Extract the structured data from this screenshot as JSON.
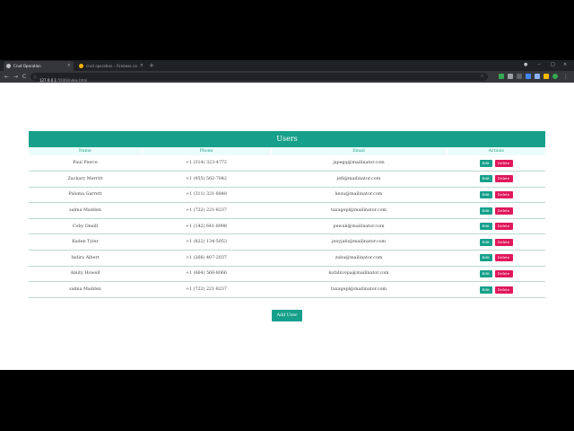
{
  "browser": {
    "tabs": [
      {
        "title": "Crud Operation",
        "active": true
      },
      {
        "title": "crud operation – Firebase conso…",
        "active": false
      }
    ],
    "new_tab": "+",
    "tab_close": "×",
    "window_controls": {
      "minimize": "–",
      "maximize": "□",
      "close": "×"
    },
    "nav": {
      "back": "←",
      "forward": "→",
      "reload": "C"
    },
    "url_host": "127.0.0.1",
    "url_path": ":5500/index.html",
    "colors": {
      "frame": "#202124",
      "toolbar": "#35363a"
    }
  },
  "page": {
    "header": "Users",
    "columns": [
      "Name",
      "Phone",
      "Email",
      "Actions"
    ],
    "rows": [
      {
        "name": "Paul Pierce",
        "phone": "+1 (314) 323-4772",
        "email": "japegq@mailinator.com"
      },
      {
        "name": "Zachary Merritt",
        "phone": "+1 (955) 562-7842",
        "email": "jefi@mailinator.com"
      },
      {
        "name": "Paloma Garrett",
        "phone": "+1 (311) 331-8848",
        "email": "kexu@mailinator.com"
      },
      {
        "name": "salma Madden",
        "phone": "+1 (722) 221-8237",
        "email": "taxugepl@mailinator.com"
      },
      {
        "name": "Coby Oneill",
        "phone": "+1 (142) 641-8998",
        "email": "pewuk@mailinator.com"
      },
      {
        "name": "Kaden Tyler",
        "phone": "+1 (822) 134-5053",
        "email": "jenyjafo@mailinator.com"
      },
      {
        "name": "Indira Albert",
        "phone": "+1 (266) 407-2037",
        "email": "zahu@mailinator.com"
      },
      {
        "name": "Amity Howell",
        "phone": "+1 (664) 566-8066",
        "email": "kofalxvopa@mailinator.com"
      },
      {
        "name": "salma Madden",
        "phone": "+1 (722) 221-8237",
        "email": "taxugepl@mailinator.com"
      }
    ],
    "edit_label": "Edit",
    "delete_label": "Delete",
    "add_user_label": "Add User",
    "colors": {
      "accent": "#16a08b",
      "danger": "#e0185c",
      "header_bg": "#ecfcfa"
    }
  }
}
